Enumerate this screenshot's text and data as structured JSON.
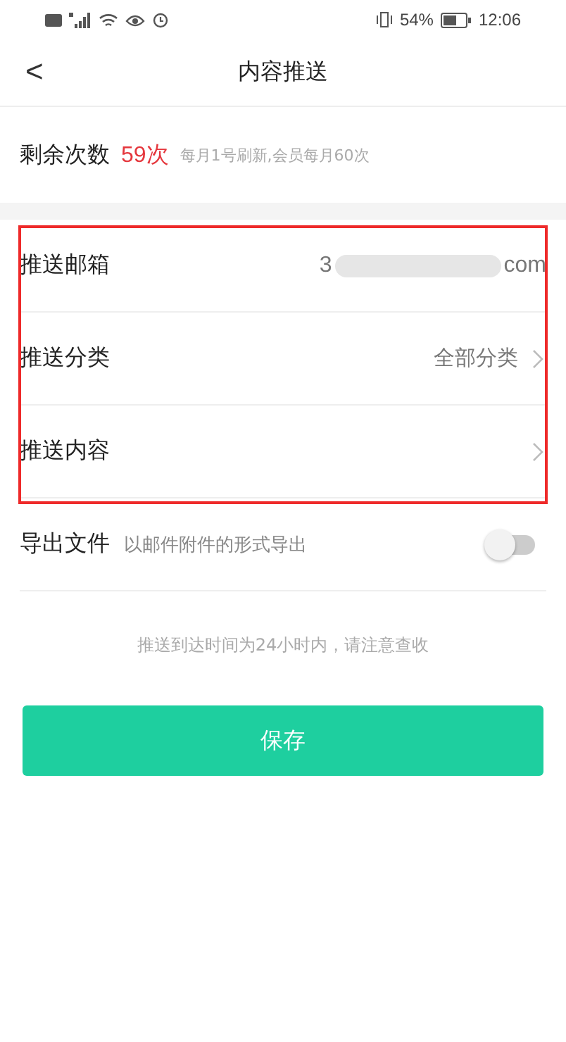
{
  "status_bar": {
    "battery": "54%",
    "time": "12:06"
  },
  "header": {
    "back": "<",
    "title": "内容推送"
  },
  "quota": {
    "label": "剩余次数",
    "count": "59次",
    "note": "每月1号刷新,会员每月60次"
  },
  "rows": [
    {
      "kind": "email",
      "label": "推送邮箱",
      "value_start": "3",
      "value_end": "com",
      "highlighted": true
    },
    {
      "kind": "link",
      "label": "推送分类",
      "value": "全部分类",
      "highlighted": true
    },
    {
      "kind": "link",
      "label": "推送内容",
      "highlighted": true
    },
    {
      "kind": "toggle",
      "label": "导出文件",
      "note": "以邮件附件的形式导出",
      "on": false,
      "highlighted": false
    }
  ],
  "hint": "推送到达时间为24小时内，请注意查收",
  "save_button": "保存"
}
